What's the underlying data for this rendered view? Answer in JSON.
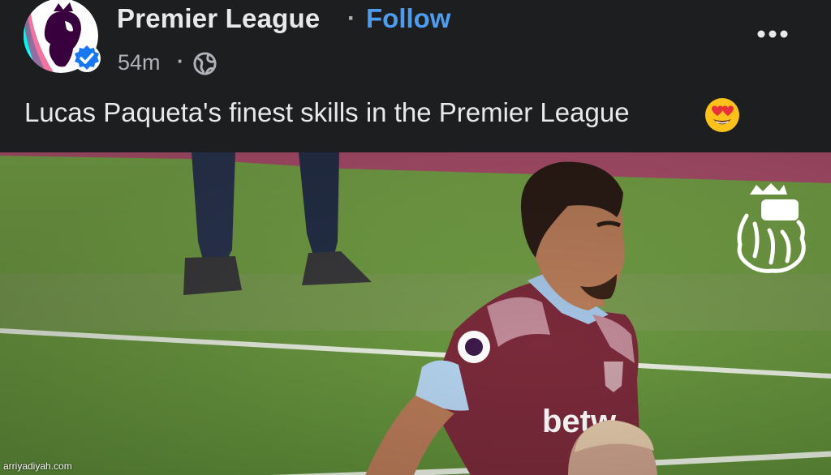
{
  "post": {
    "author": "Premier League",
    "separator": "·",
    "follow_label": "Follow",
    "time": "54m",
    "time_separator": "·",
    "audience_icon": "globe-icon",
    "verified_icon": "verified-badge-icon",
    "more_icon": "more-options-icon",
    "caption": "Lucas Paqueta's finest skills in the Premier League",
    "caption_emoji": "heart-eyes-emoji"
  },
  "video": {
    "jersey_sponsor": "betw",
    "overlay_logo": "premier-league-lion-icon"
  },
  "watermark": "arriyadiyah.com",
  "colors": {
    "header_bg": "#1d1e20",
    "follow": "#4d9cf0",
    "verified": "#1877f2",
    "pitch": "#6f9a43",
    "jersey": "#7a2a3a"
  }
}
